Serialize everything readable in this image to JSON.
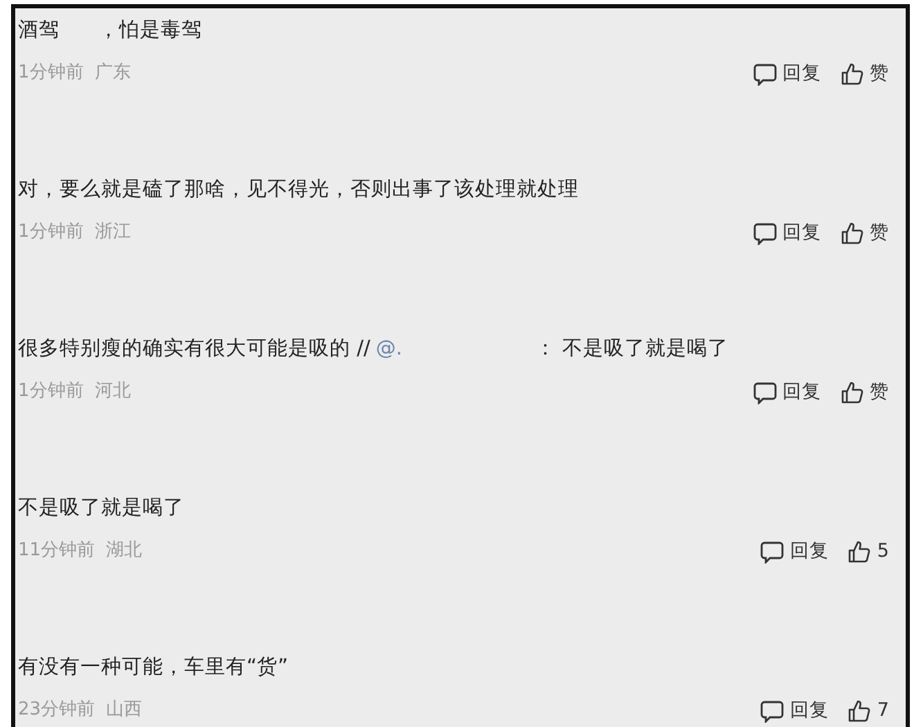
{
  "comments": [
    {
      "segments": [
        {
          "kind": "text",
          "text": "酒驾"
        },
        {
          "kind": "gap"
        },
        {
          "kind": "text",
          "text": "，怕是毒驾"
        }
      ],
      "time": "1分钟前",
      "region": "广东",
      "reply": "回复",
      "like": "赞"
    },
    {
      "segments": [
        {
          "kind": "text",
          "text": "对，要么就是磕了那啥，见不得光，否则出事了该处理就处理"
        }
      ],
      "time": "1分钟前",
      "region": "浙江",
      "reply": "回复",
      "like": "赞"
    },
    {
      "segments": [
        {
          "kind": "text",
          "text": "很多特别瘦的确实有很大可能是吸的 //"
        },
        {
          "kind": "mention",
          "text": "@."
        },
        {
          "kind": "gap"
        },
        {
          "kind": "text",
          "text": "：  不是吸了就是喝了"
        }
      ],
      "time": "1分钟前",
      "region": "河北",
      "reply": "回复",
      "like": "赞"
    },
    {
      "segments": [
        {
          "kind": "text",
          "text": "不是吸了就是喝了"
        }
      ],
      "time": "11分钟前",
      "region": "湖北",
      "reply": "回复",
      "like": "5"
    },
    {
      "segments": [
        {
          "kind": "text",
          "text": "有没有一种可能，车里有“货”"
        }
      ],
      "time": "23分钟前",
      "region": "山西",
      "reply": "回复",
      "like": "7"
    }
  ]
}
